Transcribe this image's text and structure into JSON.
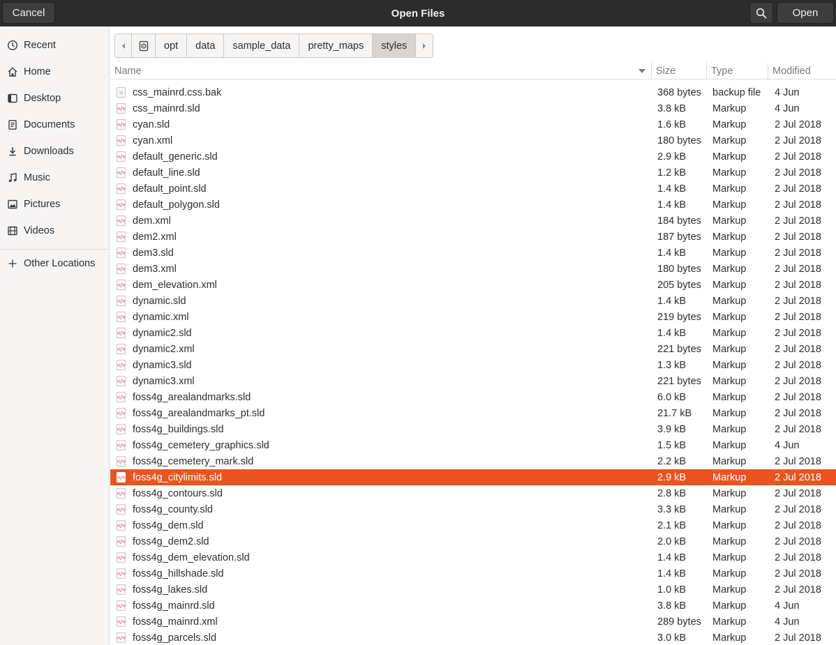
{
  "window": {
    "title": "Open Files",
    "cancel_label": "Cancel",
    "open_label": "Open",
    "search_icon": "search-icon"
  },
  "sidebar": {
    "items": [
      {
        "label": "Recent",
        "icon": "recent-icon"
      },
      {
        "label": "Home",
        "icon": "home-icon"
      },
      {
        "label": "Desktop",
        "icon": "desktop-icon"
      },
      {
        "label": "Documents",
        "icon": "documents-icon"
      },
      {
        "label": "Downloads",
        "icon": "downloads-icon"
      },
      {
        "label": "Music",
        "icon": "music-icon"
      },
      {
        "label": "Pictures",
        "icon": "pictures-icon"
      },
      {
        "label": "Videos",
        "icon": "videos-icon"
      },
      {
        "label": "Other Locations",
        "icon": "plus-icon"
      }
    ]
  },
  "pathbar": {
    "crumbs": [
      "opt",
      "data",
      "sample_data",
      "pretty_maps",
      "styles"
    ],
    "active": "styles"
  },
  "columns": {
    "name": "Name",
    "size": "Size",
    "type": "Type",
    "modified": "Modified"
  },
  "colors": {
    "selection": "#e95420",
    "header_bg": "#2c2c2c"
  },
  "files": [
    {
      "name": "css_mainrd.css.bak",
      "size": "368 bytes",
      "type": "backup file",
      "modified": "4 Jun"
    },
    {
      "name": "css_mainrd.sld",
      "size": "3.8 kB",
      "type": "Markup",
      "modified": "4 Jun"
    },
    {
      "name": "cyan.sld",
      "size": "1.6 kB",
      "type": "Markup",
      "modified": "2 Jul 2018"
    },
    {
      "name": "cyan.xml",
      "size": "180 bytes",
      "type": "Markup",
      "modified": "2 Jul 2018"
    },
    {
      "name": "default_generic.sld",
      "size": "2.9 kB",
      "type": "Markup",
      "modified": "2 Jul 2018"
    },
    {
      "name": "default_line.sld",
      "size": "1.2 kB",
      "type": "Markup",
      "modified": "2 Jul 2018"
    },
    {
      "name": "default_point.sld",
      "size": "1.4 kB",
      "type": "Markup",
      "modified": "2 Jul 2018"
    },
    {
      "name": "default_polygon.sld",
      "size": "1.4 kB",
      "type": "Markup",
      "modified": "2 Jul 2018"
    },
    {
      "name": "dem.xml",
      "size": "184 bytes",
      "type": "Markup",
      "modified": "2 Jul 2018"
    },
    {
      "name": "dem2.xml",
      "size": "187 bytes",
      "type": "Markup",
      "modified": "2 Jul 2018"
    },
    {
      "name": "dem3.sld",
      "size": "1.4 kB",
      "type": "Markup",
      "modified": "2 Jul 2018"
    },
    {
      "name": "dem3.xml",
      "size": "180 bytes",
      "type": "Markup",
      "modified": "2 Jul 2018"
    },
    {
      "name": "dem_elevation.xml",
      "size": "205 bytes",
      "type": "Markup",
      "modified": "2 Jul 2018"
    },
    {
      "name": "dynamic.sld",
      "size": "1.4 kB",
      "type": "Markup",
      "modified": "2 Jul 2018"
    },
    {
      "name": "dynamic.xml",
      "size": "219 bytes",
      "type": "Markup",
      "modified": "2 Jul 2018"
    },
    {
      "name": "dynamic2.sld",
      "size": "1.4 kB",
      "type": "Markup",
      "modified": "2 Jul 2018"
    },
    {
      "name": "dynamic2.xml",
      "size": "221 bytes",
      "type": "Markup",
      "modified": "2 Jul 2018"
    },
    {
      "name": "dynamic3.sld",
      "size": "1.3 kB",
      "type": "Markup",
      "modified": "2 Jul 2018"
    },
    {
      "name": "dynamic3.xml",
      "size": "221 bytes",
      "type": "Markup",
      "modified": "2 Jul 2018"
    },
    {
      "name": "foss4g_arealandmarks.sld",
      "size": "6.0 kB",
      "type": "Markup",
      "modified": "2 Jul 2018"
    },
    {
      "name": "foss4g_arealandmarks_pt.sld",
      "size": "21.7 kB",
      "type": "Markup",
      "modified": "2 Jul 2018"
    },
    {
      "name": "foss4g_buildings.sld",
      "size": "3.9 kB",
      "type": "Markup",
      "modified": "2 Jul 2018"
    },
    {
      "name": "foss4g_cemetery_graphics.sld",
      "size": "1.5 kB",
      "type": "Markup",
      "modified": "4 Jun"
    },
    {
      "name": "foss4g_cemetery_mark.sld",
      "size": "2.2 kB",
      "type": "Markup",
      "modified": "2 Jul 2018"
    },
    {
      "name": "foss4g_citylimits.sld",
      "size": "2.9 kB",
      "type": "Markup",
      "modified": "2 Jul 2018",
      "selected": true
    },
    {
      "name": "foss4g_contours.sld",
      "size": "2.8 kB",
      "type": "Markup",
      "modified": "2 Jul 2018"
    },
    {
      "name": "foss4g_county.sld",
      "size": "3.3 kB",
      "type": "Markup",
      "modified": "2 Jul 2018"
    },
    {
      "name": "foss4g_dem.sld",
      "size": "2.1 kB",
      "type": "Markup",
      "modified": "2 Jul 2018"
    },
    {
      "name": "foss4g_dem2.sld",
      "size": "2.0 kB",
      "type": "Markup",
      "modified": "2 Jul 2018"
    },
    {
      "name": "foss4g_dem_elevation.sld",
      "size": "1.4 kB",
      "type": "Markup",
      "modified": "2 Jul 2018"
    },
    {
      "name": "foss4g_hillshade.sld",
      "size": "1.4 kB",
      "type": "Markup",
      "modified": "2 Jul 2018"
    },
    {
      "name": "foss4g_lakes.sld",
      "size": "1.0 kB",
      "type": "Markup",
      "modified": "2 Jul 2018"
    },
    {
      "name": "foss4g_mainrd.sld",
      "size": "3.8 kB",
      "type": "Markup",
      "modified": "4 Jun"
    },
    {
      "name": "foss4g_mainrd.xml",
      "size": "289 bytes",
      "type": "Markup",
      "modified": "4 Jun"
    },
    {
      "name": "foss4g_parcels.sld",
      "size": "3.0 kB",
      "type": "Markup",
      "modified": "2 Jul 2018"
    }
  ]
}
